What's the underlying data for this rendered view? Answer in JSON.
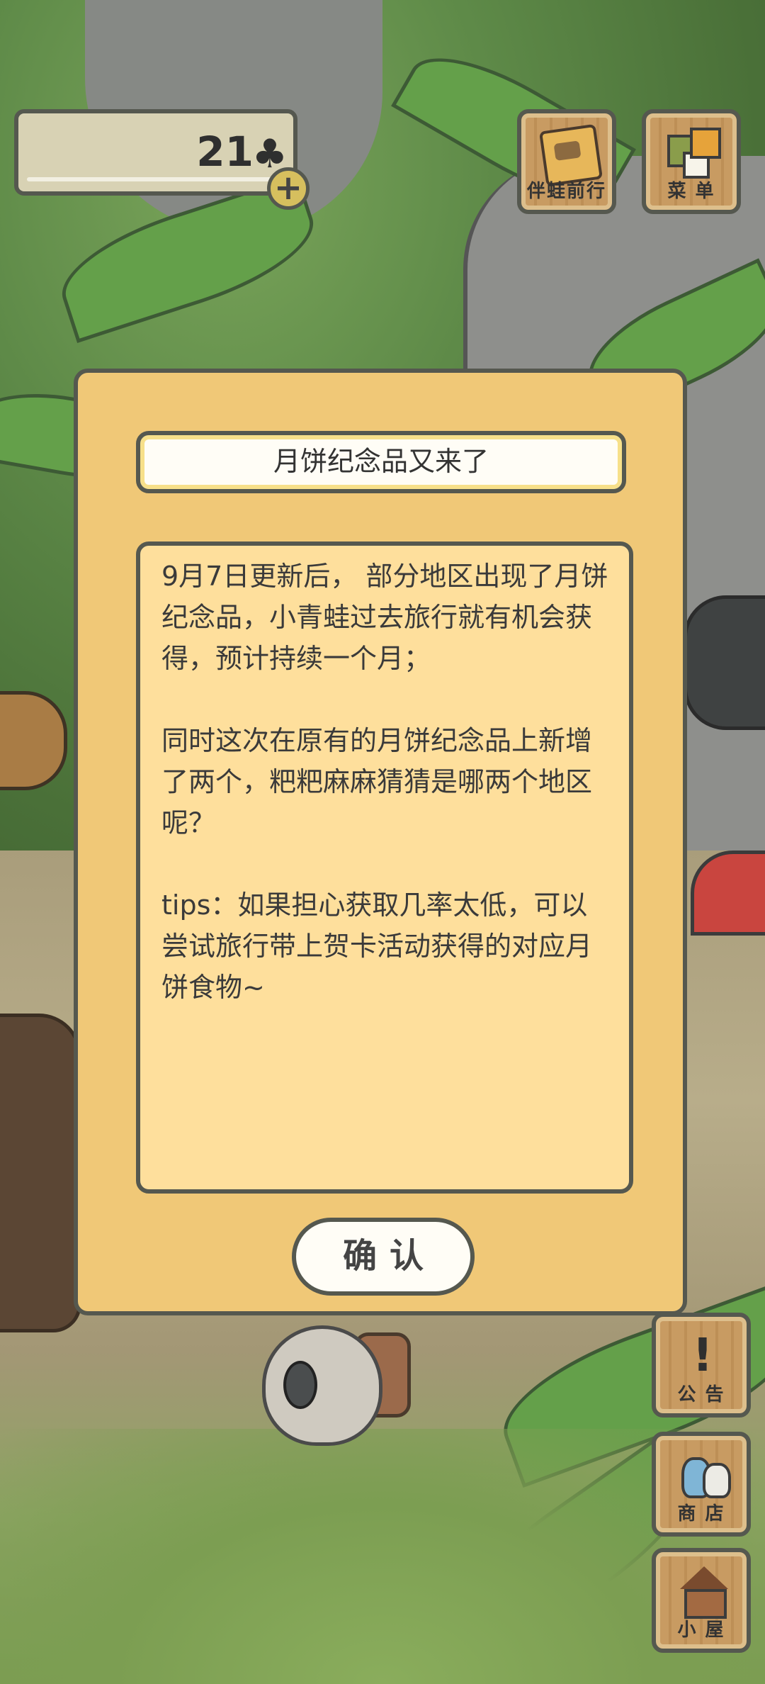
{
  "currency": {
    "value": "21",
    "icon": "clover-icon"
  },
  "top_buttons": [
    {
      "label": "伴蛙前行",
      "icon": "journal-icon"
    },
    {
      "label": "菜 单",
      "icon": "menu-icon"
    }
  ],
  "side_buttons": [
    {
      "label": "公 告",
      "icon": "notice-icon",
      "glyph": "!"
    },
    {
      "label": "商 店",
      "icon": "shop-icon"
    },
    {
      "label": "小 屋",
      "icon": "house-icon"
    }
  ],
  "dialog": {
    "title": "月饼纪念品又来了",
    "body": "9月7日更新后， 部分地区出现了月饼纪念品，小青蛙过去旅行就有机会获得，预计持续一个月；\n\n同时这次在原有的月饼纪念品上新增了两个，粑粑麻麻猜猜是哪两个地区呢？\n\ntips：如果担心获取几率太低，可以尝试旅行带上贺卡活动获得的对应月饼食物~",
    "confirm_label": "确认"
  },
  "colors": {
    "dialog_bg": "#f0c877",
    "body_bg": "#fedf9c",
    "outline": "#55584f"
  }
}
